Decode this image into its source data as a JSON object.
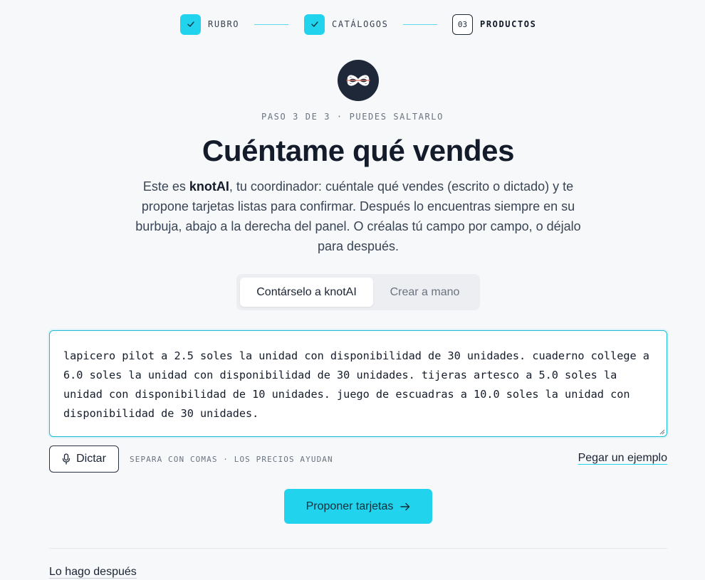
{
  "stepper": {
    "steps": [
      {
        "label": "RUBRO",
        "state": "done"
      },
      {
        "label": "CATÁLOGOS",
        "state": "done"
      },
      {
        "label": "PRODUCTOS",
        "state": "current",
        "number": "03"
      }
    ]
  },
  "logo": {
    "icon": "knot-icon"
  },
  "eyebrow": "PASO 3 DE 3 · PUEDES SALTARLO",
  "title": "Cuéntame qué vendes",
  "lead": {
    "prefix": "Este es ",
    "brand": "knotAI",
    "suffix": ", tu coordinador: cuéntale qué vendes (escrito o dictado) y te propone tarjetas listas para confirmar. Después lo encuentras siempre en su burbuja, abajo a la derecha del panel. O créalas tú campo por campo, o déjalo para después."
  },
  "tabs": {
    "ai": "Contárselo a knotAI",
    "manual": "Crear a mano",
    "selected": "ai"
  },
  "input": {
    "value": "lapicero pilot a 2.5 soles la unidad con disponibilidad de 30 unidades. cuaderno college a 6.0 soles la unidad con disponibilidad de 30 unidades. tijeras artesco a 5.0 soles la unidad con disponibilidad de 10 unidades. juego de escuadras a 10.0 soles la unidad con disponibilidad de 30 unidades."
  },
  "actions": {
    "dictate": "Dictar",
    "hint": "SEPARA CON COMAS · LOS PRECIOS AYUDAN",
    "paste_example": "Pegar un ejemplo",
    "propose": "Proponer tarjetas",
    "later": "Lo hago después"
  },
  "colors": {
    "accent": "#22d3ee",
    "dark": "#1e2838"
  }
}
